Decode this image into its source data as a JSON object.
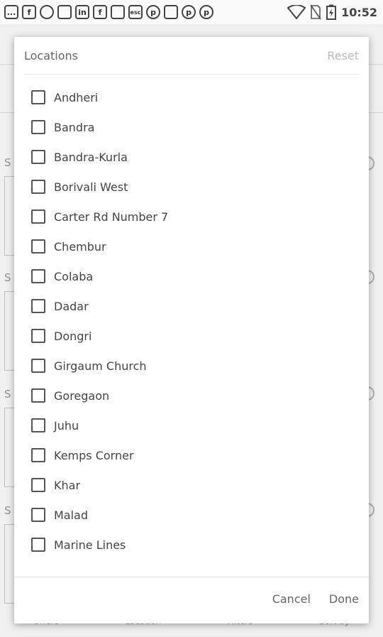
{
  "status_bar": {
    "icons": [
      "chat-icon",
      "f",
      "whatsapp-icon",
      "cat-icon",
      "in",
      "f",
      "cat-icon",
      "esc",
      "pinterest-icon",
      "cat-icon",
      "pinterest-icon",
      "pinterest-icon"
    ],
    "notif_labels": [
      "...",
      "f",
      "",
      "",
      "in",
      "f",
      "",
      "esc",
      "p",
      "",
      "p",
      "p"
    ],
    "time": "10:52"
  },
  "dialog": {
    "title": "Locations",
    "reset_label": "Reset",
    "items": [
      {
        "label": "Andheri",
        "checked": false
      },
      {
        "label": "Bandra",
        "checked": false
      },
      {
        "label": "Bandra-Kurla",
        "checked": false
      },
      {
        "label": "Borivali West",
        "checked": false
      },
      {
        "label": "Carter Rd Number 7",
        "checked": false
      },
      {
        "label": "Chembur",
        "checked": false
      },
      {
        "label": "Colaba",
        "checked": false
      },
      {
        "label": "Dadar",
        "checked": false
      },
      {
        "label": "Dongri",
        "checked": false
      },
      {
        "label": "Girgaum Church",
        "checked": false
      },
      {
        "label": "Goregaon",
        "checked": false
      },
      {
        "label": "Juhu",
        "checked": false
      },
      {
        "label": "Kemps Corner",
        "checked": false
      },
      {
        "label": "Khar",
        "checked": false
      },
      {
        "label": "Malad",
        "checked": false
      },
      {
        "label": "Marine Lines",
        "checked": false
      }
    ],
    "cancel_label": "Cancel",
    "done_label": "Done"
  },
  "background": {
    "bottom_tabs": [
      "Offers",
      "Location",
      "Filters",
      "Sort by"
    ]
  }
}
